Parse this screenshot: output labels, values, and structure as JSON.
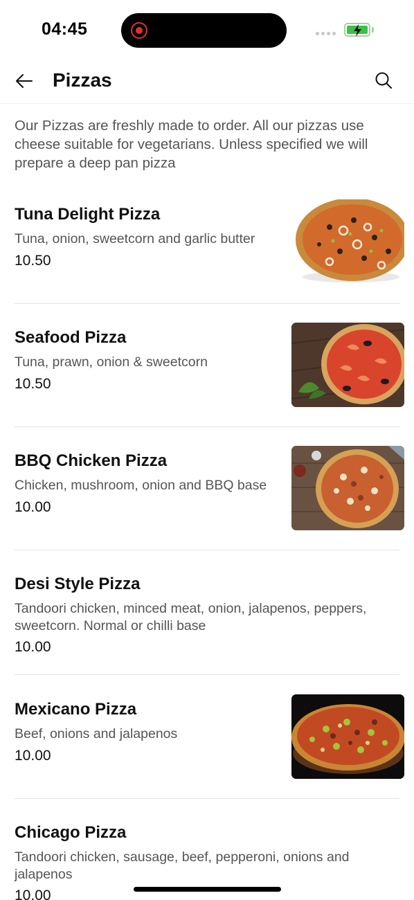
{
  "status": {
    "time": "04:45"
  },
  "header": {
    "title": "Pizzas"
  },
  "intro": "Our Pizzas are freshly made to order. All our pizzas use cheese suitable for vegetarians. Unless specified we will prepare a deep pan pizza",
  "items": [
    {
      "name": "Tuna Delight Pizza",
      "desc": "Tuna, onion, sweetcorn and garlic butter",
      "price": "10.50",
      "image": "tuna-pizza-photo"
    },
    {
      "name": "Seafood Pizza",
      "desc": "Tuna, prawn, onion & sweetcorn",
      "price": "10.50",
      "image": "seafood-pizza-photo"
    },
    {
      "name": "BBQ Chicken Pizza",
      "desc": "Chicken, mushroom, onion and BBQ base",
      "price": "10.00",
      "image": "bbq-chicken-pizza-photo"
    },
    {
      "name": "Desi Style Pizza",
      "desc": "Tandoori chicken, minced meat, onion, jalapenos, peppers, sweetcorn. Normal or chilli base",
      "price": "10.00",
      "image": ""
    },
    {
      "name": "Mexicano Pizza",
      "desc": "Beef, onions and jalapenos",
      "price": "10.00",
      "image": "mexicano-pizza-photo"
    },
    {
      "name": "Chicago Pizza",
      "desc": "Tandoori chicken, sausage, beef, pepperoni, onions and jalapenos",
      "price": "10.00",
      "image": ""
    }
  ]
}
